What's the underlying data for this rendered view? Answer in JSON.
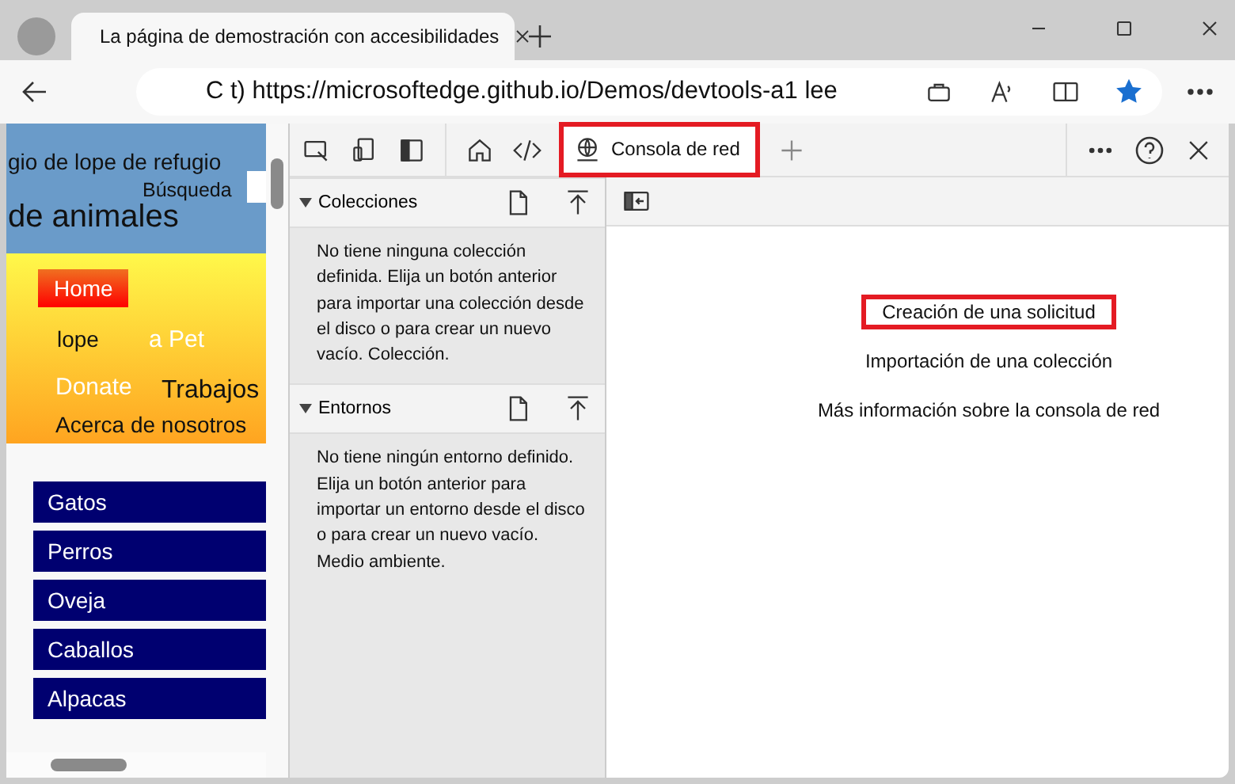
{
  "browser": {
    "tab_title": "La página de demostración con accesibilidades",
    "address": "C t) https://microsoftedge.github.io/Demos/devtools-a1 lee"
  },
  "webpage": {
    "title_line_1": "gio de lope de refugio",
    "search_label": "Búsqueda",
    "title_line_2": "de animales",
    "nav": [
      {
        "label": "Home",
        "selected": true
      },
      {
        "label": "lope",
        "selected": false
      },
      {
        "label": "a Pet",
        "selected": false
      },
      {
        "label": "Donate",
        "selected": false
      },
      {
        "label": "Trabajos",
        "selected": false
      },
      {
        "label": "Acerca de nosotros",
        "selected": false
      }
    ],
    "categories": [
      "Gatos",
      "Perros",
      "Oveja",
      "Caballos",
      "Alpacas"
    ]
  },
  "devtools": {
    "tabs": [
      {
        "label": "Consola de red",
        "selected": true,
        "highlighted": true
      }
    ],
    "sections": [
      {
        "title": "Colecciones",
        "expanded": true,
        "text": "No tiene ninguna colección definida. Elija un botón anterior para importar una colección desde el disco o para crear un nuevo vacío. Colección."
      },
      {
        "title": "Entornos",
        "expanded": true,
        "text": "No tiene ningún entorno definido. Elija un botón anterior para importar un entorno desde el disco o para crear un nuevo vacío. Medio ambiente."
      }
    ],
    "links": [
      {
        "label": "Creación de una solicitud",
        "highlighted": true
      },
      {
        "label": "Importación de una colección",
        "highlighted": false
      },
      {
        "label": "Más información sobre la consola de red",
        "highlighted": false
      }
    ]
  }
}
